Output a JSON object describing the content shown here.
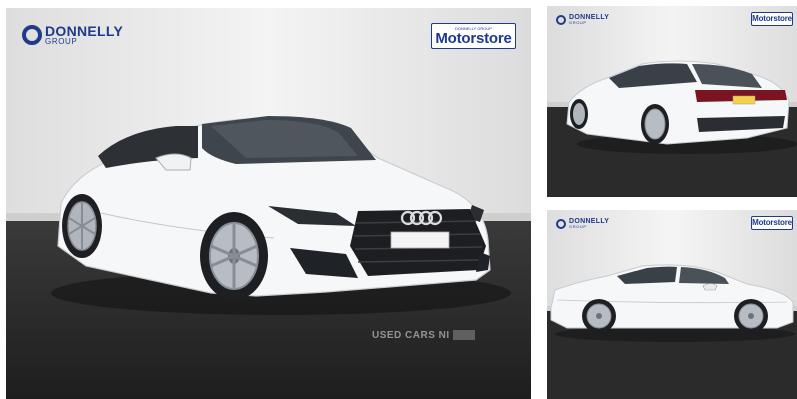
{
  "main_photo": {
    "dealer_logo": {
      "name": "DONNELLY",
      "sub": "GROUP"
    },
    "store_badge": {
      "pre": "DONNELLY GROUP",
      "label": "Motorstore"
    },
    "watermark": "USED CARS NI",
    "car_color": "#f6f7f8"
  },
  "thumbnails": [
    {
      "dealer_logo": {
        "name": "DONNELLY",
        "sub": "GROUP"
      },
      "store_badge": {
        "label": "Motorstore"
      },
      "view": "rear three-quarter"
    },
    {
      "dealer_logo": {
        "name": "DONNELLY",
        "sub": "GROUP"
      },
      "store_badge": {
        "label": "Motorstore"
      },
      "view": "side profile"
    }
  ],
  "colors": {
    "brand_blue": "#1f3a8a",
    "floor": "#2b2b2b",
    "backdrop": "#e9e9e9"
  }
}
